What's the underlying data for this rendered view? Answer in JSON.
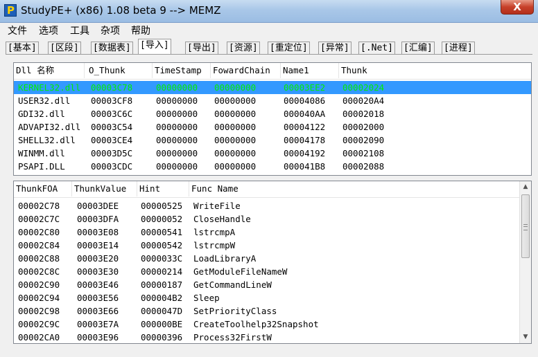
{
  "window": {
    "title": "StudyPE+ (x86) 1.08 beta 9  --> MEMZ",
    "close_label": "X"
  },
  "menu": [
    "文件",
    "选项",
    "工具",
    "杂项",
    "帮助"
  ],
  "tabs": [
    "[基本]",
    "[区段]",
    "[数据表]",
    "[导入]",
    "[导出]",
    "[资源]",
    "[重定位]",
    "[异常]",
    "[.Net]",
    "[汇编]",
    "[进程]"
  ],
  "active_tab": "[导入]",
  "dll_table": {
    "columns": [
      "Dll 名称",
      "O_Thunk",
      "TimeStamp",
      "FowardChain",
      "Name1",
      "Thunk"
    ],
    "rows": [
      [
        "KERNEL32.dll",
        "00003C78",
        "00000000",
        "00000000",
        "00003EE2",
        "00002024"
      ],
      [
        "USER32.dll",
        "00003CF8",
        "00000000",
        "00000000",
        "00004086",
        "000020A4"
      ],
      [
        "GDI32.dll",
        "00003C6C",
        "00000000",
        "00000000",
        "000040AA",
        "00002018"
      ],
      [
        "ADVAPI32.dll",
        "00003C54",
        "00000000",
        "00000000",
        "00004122",
        "00002000"
      ],
      [
        "SHELL32.dll",
        "00003CE4",
        "00000000",
        "00000000",
        "00004178",
        "00002090"
      ],
      [
        "WINMM.dll",
        "00003D5C",
        "00000000",
        "00000000",
        "00004192",
        "00002108"
      ],
      [
        "PSAPI.DLL",
        "00003CDC",
        "00000000",
        "00000000",
        "000041B8",
        "00002088"
      ]
    ]
  },
  "func_table": {
    "columns": [
      "ThunkFOA",
      "ThunkValue",
      "Hint",
      "Func Name"
    ],
    "rows": [
      [
        "00002C78",
        "00003DEE",
        "00000525",
        "WriteFile"
      ],
      [
        "00002C7C",
        "00003DFA",
        "00000052",
        "CloseHandle"
      ],
      [
        "00002C80",
        "00003E08",
        "00000541",
        "lstrcmpA"
      ],
      [
        "00002C84",
        "00003E14",
        "00000542",
        "lstrcmpW"
      ],
      [
        "00002C88",
        "00003E20",
        "0000033C",
        "LoadLibraryA"
      ],
      [
        "00002C8C",
        "00003E30",
        "00000214",
        "GetModuleFileNameW"
      ],
      [
        "00002C90",
        "00003E46",
        "00000187",
        "GetCommandLineW"
      ],
      [
        "00002C94",
        "00003E56",
        "000004B2",
        "Sleep"
      ],
      [
        "00002C98",
        "00003E66",
        "0000047D",
        "SetPriorityClass"
      ],
      [
        "00002C9C",
        "00003E7A",
        "000000BE",
        "CreateToolhelp32Snapshot"
      ],
      [
        "00002CA0",
        "00003E96",
        "00000396",
        "Process32FirstW"
      ]
    ]
  },
  "icons": {
    "app": "studype-app-icon",
    "scroll_up": "scroll-up-arrow-icon",
    "scroll_down": "scroll-down-arrow-icon"
  },
  "colors": {
    "selection": "#3399ff",
    "selection_text": "#00ee00"
  }
}
